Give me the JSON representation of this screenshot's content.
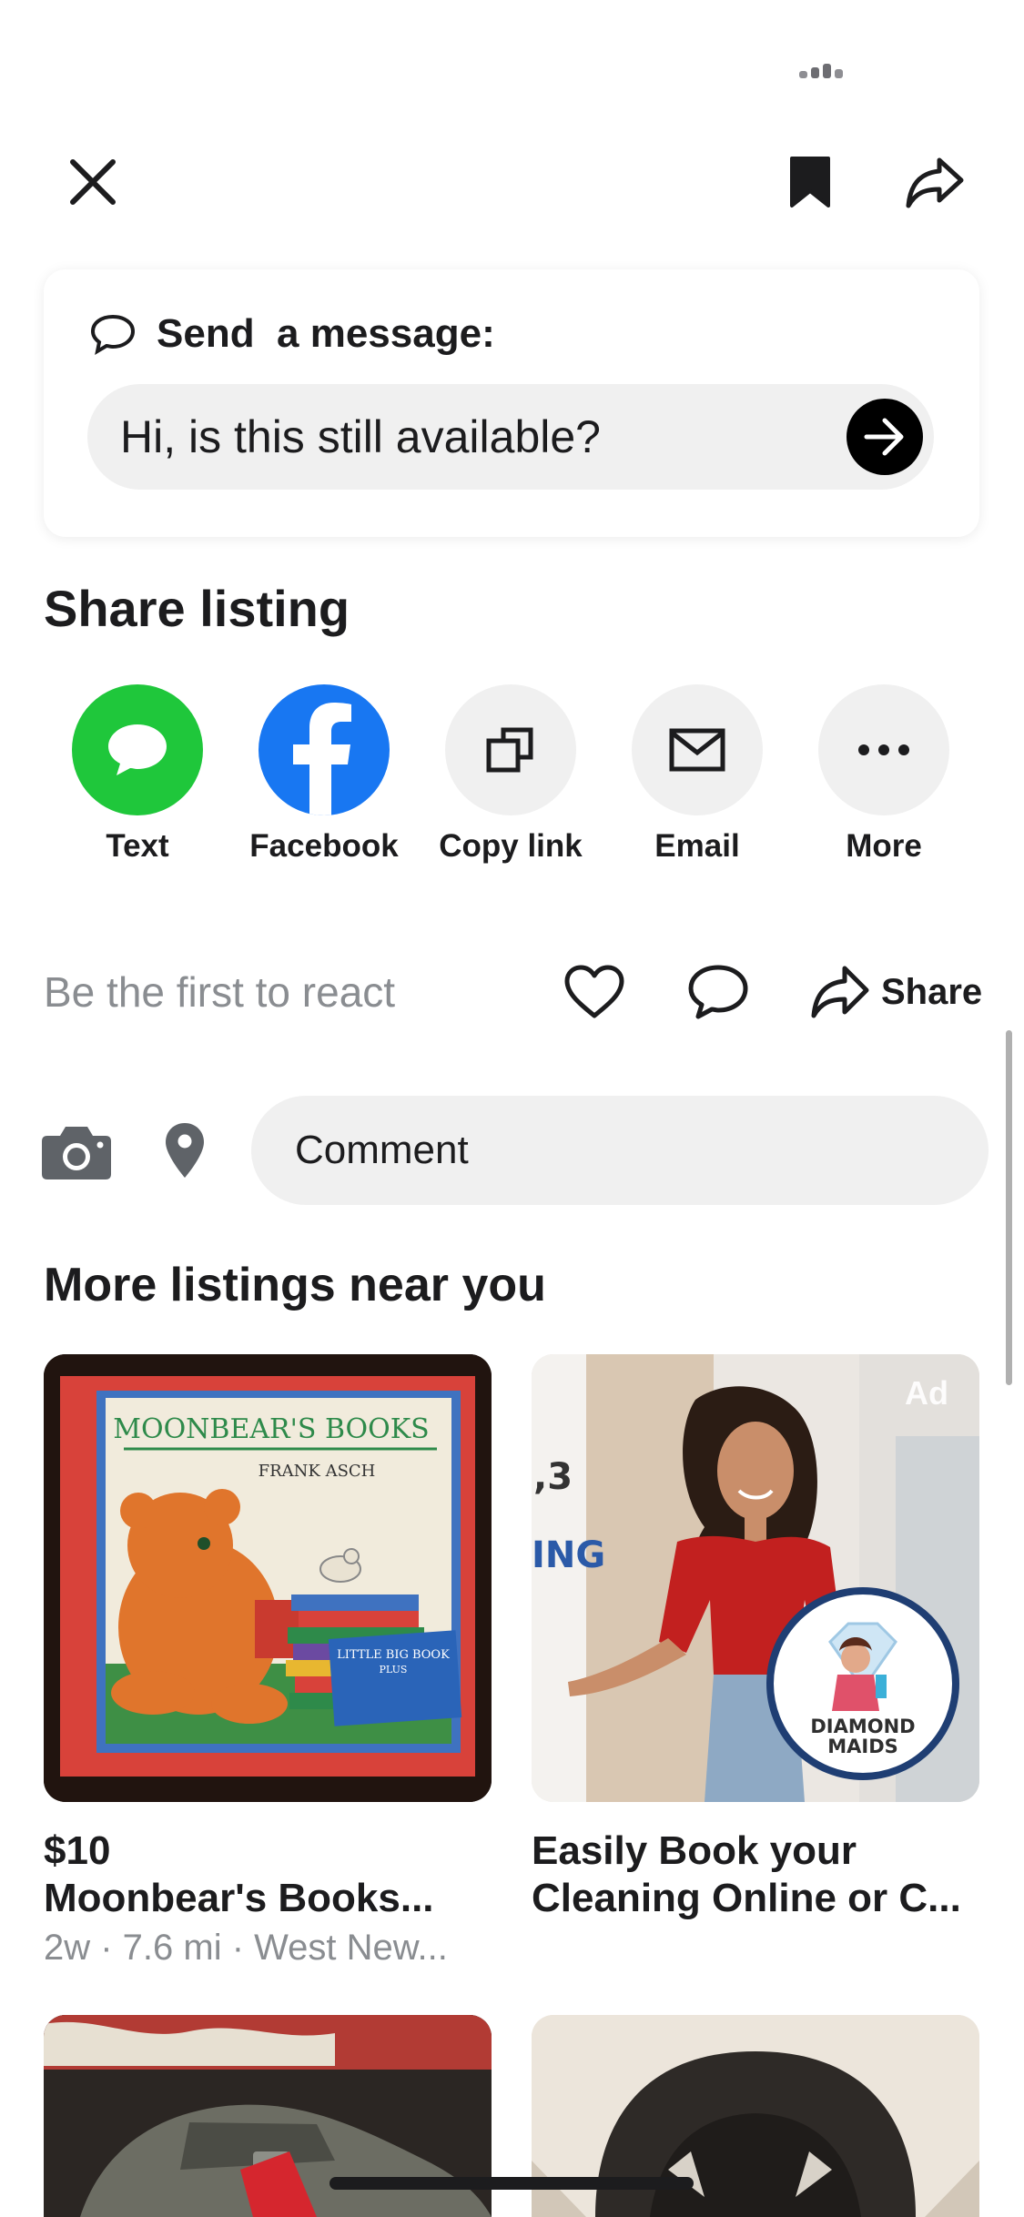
{
  "topbar": {
    "close_icon": "close-icon",
    "bookmark_icon": "bookmark-icon",
    "share_icon": "share-arrow-icon"
  },
  "message": {
    "title": "Send  a message:",
    "input_value": "Hi, is this still available?",
    "send_icon": "arrow-right-icon"
  },
  "share_listing": {
    "title": "Share listing",
    "options": [
      {
        "label": "Text",
        "icon": "chat-bubble-icon",
        "color": "#1fc73b"
      },
      {
        "label": "Facebook",
        "icon": "facebook-icon",
        "color": "#1877f2"
      },
      {
        "label": "Copy link",
        "icon": "copy-icon",
        "color": "#f0f0f0"
      },
      {
        "label": "Email",
        "icon": "mail-icon",
        "color": "#f0f0f0"
      },
      {
        "label": "More",
        "icon": "ellipsis-icon",
        "color": "#f0f0f0"
      }
    ]
  },
  "reactions": {
    "prompt": "Be the first to react",
    "share_label": "Share"
  },
  "comment": {
    "placeholder": "Comment"
  },
  "more_listings": {
    "title": "More listings near you",
    "items": [
      {
        "price": "$10",
        "title": "Moonbear's Books...",
        "meta": "2w · 7.6 mi · West New...",
        "image_text": {
          "heading": "MOONBEAR'S BOOKS",
          "author": "FRANK ASCH",
          "badge": "LITTLE BIG BOOK",
          "badge_sub": "PLUS"
        }
      },
      {
        "ad_badge": "Ad",
        "title_line1": "Easily Book your",
        "title_line2": "Cleaning Online or C...",
        "image_text": {
          "side_1": "?",
          "side_2": ",3",
          "side_3": "ING",
          "logo_line1": "DIAMOND",
          "logo_line2": "MAIDS"
        }
      }
    ]
  }
}
